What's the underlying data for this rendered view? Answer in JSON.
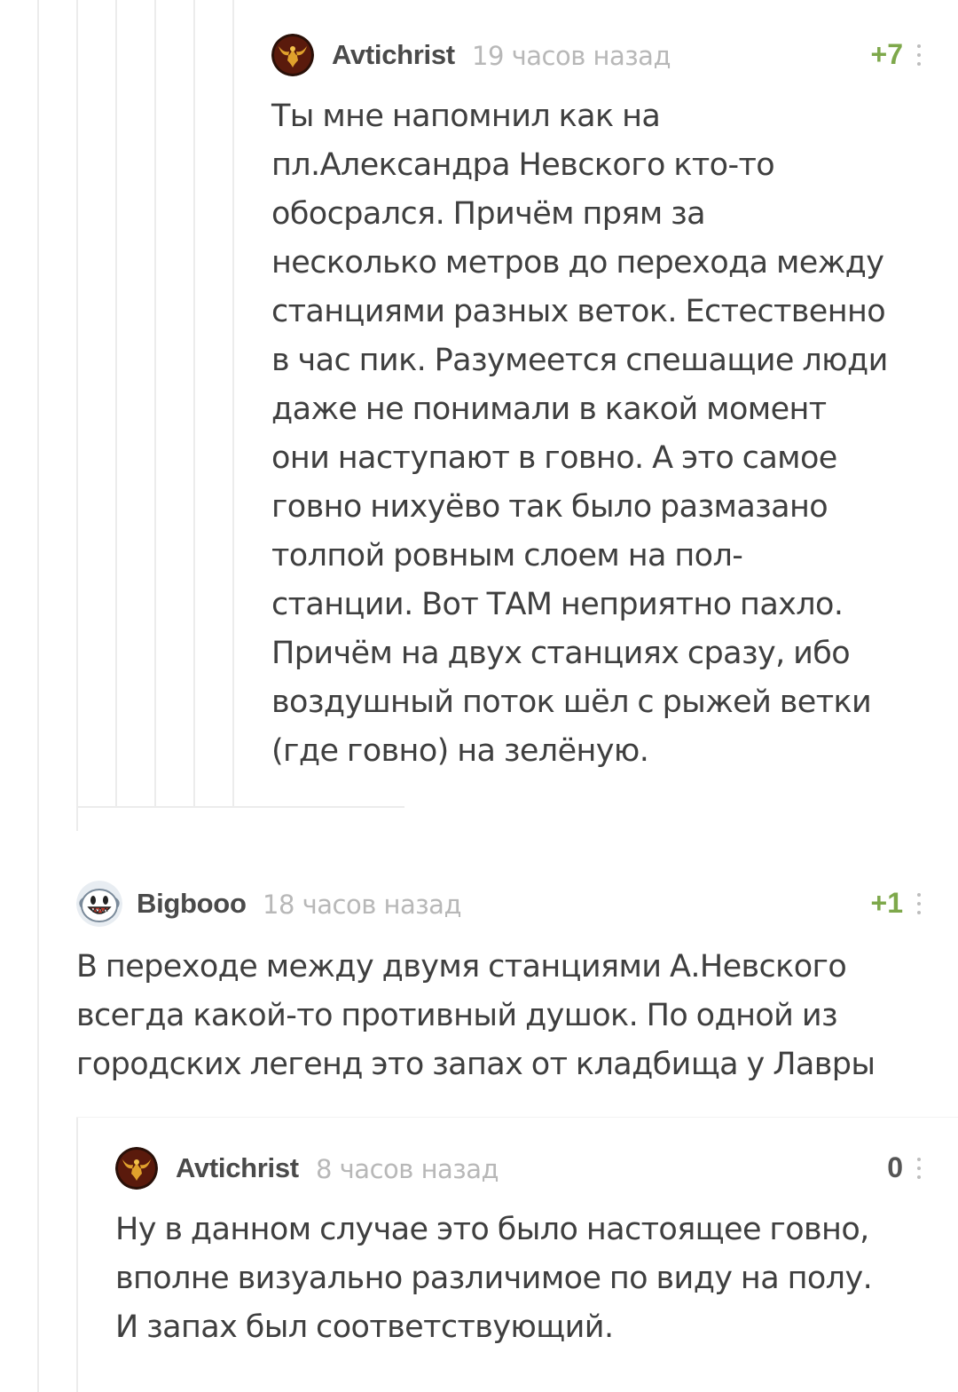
{
  "colors": {
    "thread_line": "#ececec",
    "author": "#4a4a4a",
    "time": "#b8b8b8",
    "text": "#3f3f3f",
    "rating_positive": "#7ea84b",
    "rating_neutral": "#555555"
  },
  "comments": [
    {
      "author": "Avtichrist",
      "time": "19 часов назад",
      "rating": "+7",
      "avatar_icon": "golden-eagle-emblem-icon",
      "lines": [
        "Ты мне напомнил как на",
        "пл.Александра Невского кто-то",
        "обосрался. Причём прям за",
        "несколько метров до перехода между",
        "станциями разных веток. Естественно",
        "в час пик. Разумеется спешащие люди",
        "даже не понимали в какой момент",
        "они наступают в говно. А это самое",
        "говно нихуёво так было размазано",
        "толпой ровным слоем на пол-",
        "станции. Вот ТАМ неприятно пахло.",
        "Причём на двух станциях сразу, ибо",
        "воздушный поток шёл с рыжей ветки",
        "(где говно) на зелёную."
      ]
    },
    {
      "author": "Bigbooo",
      "time": "18 часов назад",
      "rating": "+1",
      "avatar_icon": "boo-ghost-icon",
      "lines": [
        "В переходе между двумя станциями А.Невского",
        "всегда какой-то противный душок. По одной из",
        "городских легенд это запах от кладбища у Лавры"
      ]
    },
    {
      "author": "Avtichrist",
      "time": "8 часов назад",
      "rating": "0",
      "avatar_icon": "golden-eagle-emblem-icon",
      "lines": [
        "Ну в данном случае это было настоящее говно,",
        "вполне визуально различимое по виду на полу.",
        "И запах был соответствующий."
      ]
    }
  ]
}
